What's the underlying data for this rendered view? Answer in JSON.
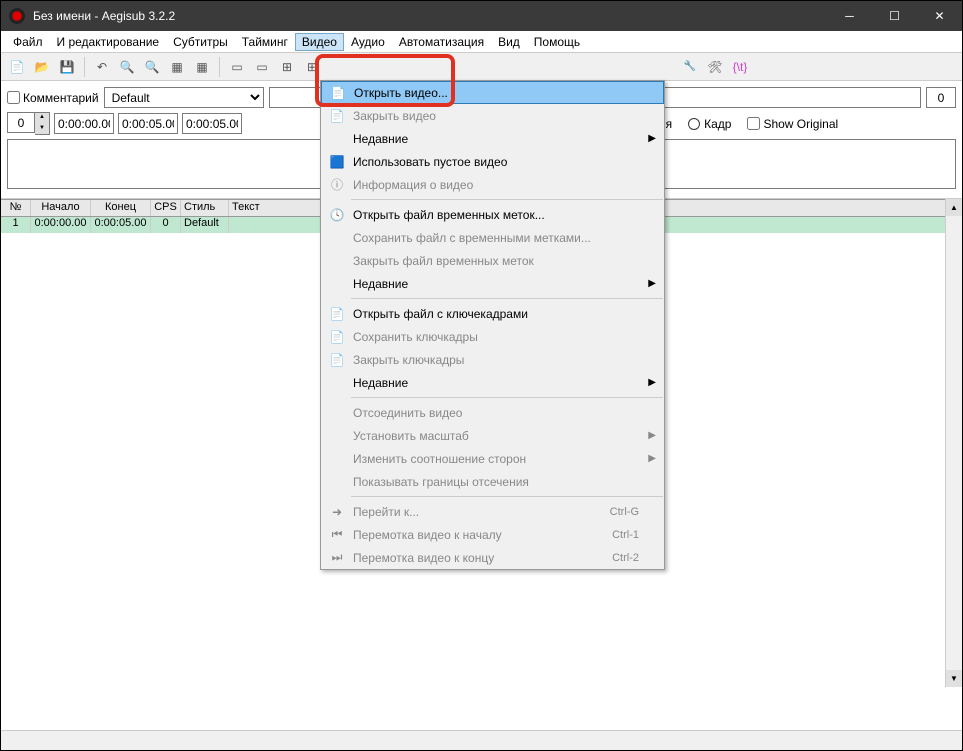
{
  "window": {
    "title": "Без имени - Aegisub 3.2.2"
  },
  "menubar": {
    "file": "Файл",
    "edit": "И редактирование",
    "subtitles": "Субтитры",
    "timing": "Тайминг",
    "video": "Видео",
    "audio": "Аудио",
    "automation": "Автоматизация",
    "view": "Вид",
    "help": "Помощь"
  },
  "edit_panel": {
    "comment": "Комментарий",
    "style": "Default",
    "maxchar": "0",
    "layer": "0",
    "start": "0:00:00.00",
    "end": "0:00:05.00",
    "dur": "0:00:05.00",
    "time_label": "Время",
    "frame_label": "Кадр",
    "show_original": "Show Original"
  },
  "grid": {
    "headers": {
      "num": "№",
      "start": "Начало",
      "end": "Конец",
      "cps": "CPS",
      "style": "Стиль",
      "text": "Текст"
    },
    "row1": {
      "num": "1",
      "start": "0:00:00.00",
      "end": "0:00:05.00",
      "cps": "0",
      "style": "Default",
      "text": ""
    }
  },
  "video_menu": {
    "open_video": "Открыть видео...",
    "close_video": "Закрыть видео",
    "recent1": "Недавние",
    "use_dummy": "Использовать пустое видео",
    "info": "Информация о видео",
    "open_timecodes": "Открыть файл временных меток...",
    "save_timecodes": "Сохранить файл с временными метками...",
    "close_timecodes": "Закрыть файл временных меток",
    "recent2": "Недавние",
    "open_keyframes": "Открыть файл с ключекадрами",
    "save_keyframes": "Сохранить ключкадры",
    "close_keyframes": "Закрыть ключкадры",
    "recent3": "Недавние",
    "detach": "Отсоединить видео",
    "set_zoom": "Установить масштаб",
    "aspect": "Изменить соотношение сторон",
    "show_overscan": "Показывать границы отсечения",
    "jump": "Перейти к...",
    "jump_start": "Перемотка видео к началу",
    "jump_end": "Перемотка видео к концу",
    "sc_g": "Ctrl-G",
    "sc_1": "Ctrl-1",
    "sc_2": "Ctrl-2"
  }
}
